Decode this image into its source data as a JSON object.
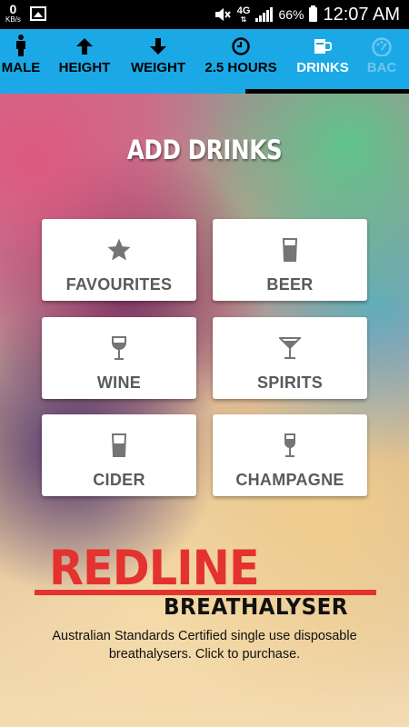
{
  "status_bar": {
    "data_rate": "0",
    "data_unit": "KB/s",
    "network": "4G",
    "network_arrows": "⇅",
    "battery": "66%",
    "time": "12:07 AM"
  },
  "tabs": [
    {
      "label": "MALE",
      "icon": "person-icon",
      "state": "normal"
    },
    {
      "label": "HEIGHT",
      "icon": "arrow-up-icon",
      "state": "normal"
    },
    {
      "label": "WEIGHT",
      "icon": "arrow-down-icon",
      "state": "normal"
    },
    {
      "label": "2.5 HOURS",
      "icon": "clock-icon",
      "state": "normal"
    },
    {
      "label": "DRINKS",
      "icon": "drinks-icon",
      "state": "active"
    },
    {
      "label": "BAC",
      "icon": "gauge-icon",
      "state": "disabled"
    }
  ],
  "progress": 0.6,
  "title": "ADD DRINKS",
  "drinks": [
    {
      "label": "FAVOURITES",
      "icon": "star-icon"
    },
    {
      "label": "BEER",
      "icon": "beer-glass-icon"
    },
    {
      "label": "WINE",
      "icon": "wine-glass-icon"
    },
    {
      "label": "SPIRITS",
      "icon": "cocktail-glass-icon"
    },
    {
      "label": "CIDER",
      "icon": "cider-glass-icon"
    },
    {
      "label": "CHAMPAGNE",
      "icon": "champagne-glass-icon"
    }
  ],
  "ad": {
    "brand": "REDLINE",
    "subtitle": "BREATHALYSER",
    "text_line1": "Australian Standards Certified single use disposable",
    "text_line2": "breathalysers. Click to purchase."
  },
  "colors": {
    "tab_bar": "#1aa9e6",
    "brand_red": "#e4322f"
  }
}
